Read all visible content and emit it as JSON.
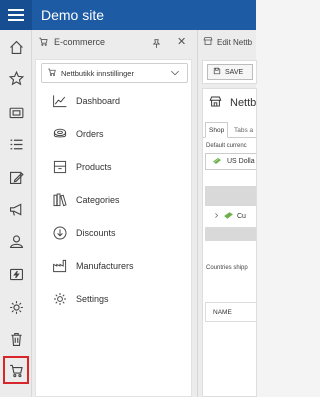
{
  "app": {
    "title": "Demo site"
  },
  "leftbar": {
    "icons": [
      "home-icon",
      "star-icon",
      "media-folder-icon",
      "list-icon",
      "edit-icon",
      "megaphone-icon",
      "users-icon",
      "lightning-icon",
      "settings-icon",
      "trash-icon",
      "cart-icon"
    ],
    "active": "cart-icon",
    "active_color": "#d9262a"
  },
  "panel1": {
    "title": "E-commerce",
    "dropdown": {
      "value": "Nettbutikk innstillinger"
    },
    "menu": [
      {
        "label": "Dashboard",
        "icon": "chart-icon"
      },
      {
        "label": "Orders",
        "icon": "coins-icon"
      },
      {
        "label": "Products",
        "icon": "box-icon"
      },
      {
        "label": "Categories",
        "icon": "books-icon"
      },
      {
        "label": "Discounts",
        "icon": "discount-icon"
      },
      {
        "label": "Manufacturers",
        "icon": "factory-icon"
      },
      {
        "label": "Settings",
        "icon": "gear-icon"
      }
    ]
  },
  "panel2": {
    "title": "Edit Nettb",
    "save_label": "SAVE",
    "heading": "Nettb",
    "tabs": [
      "Shop",
      "Tabs a"
    ],
    "default_currency_label": "Default currenc",
    "currency_value": "US Dolla",
    "tree_item": "Cu",
    "countries_label": "Countries shipp",
    "column_name": "NAME"
  },
  "colors": {
    "brand": "#1d5ba5",
    "accent_red": "#d9262a"
  }
}
